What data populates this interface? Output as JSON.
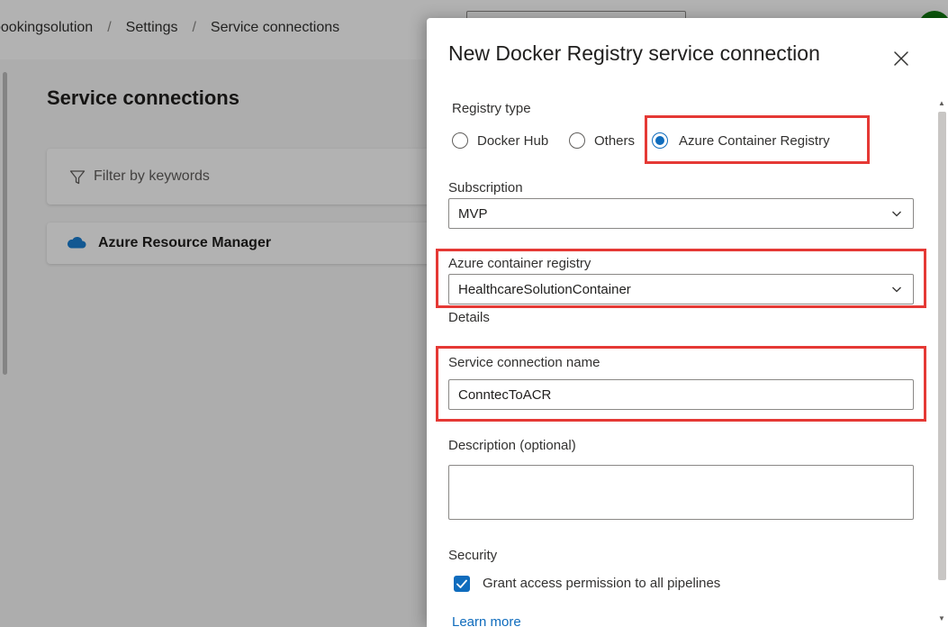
{
  "background": {
    "breadcrumb": [
      "bookingsolution",
      "Settings",
      "Service connections"
    ],
    "title": "Service connections",
    "filter_placeholder": "Filter by keywords",
    "connections": [
      "Azure Resource Manager"
    ]
  },
  "panel": {
    "title": "New Docker Registry service connection",
    "registry_type_label": "Registry type",
    "registry_types": [
      "Docker Hub",
      "Others",
      "Azure Container Registry"
    ],
    "registry_type_selected": "Azure Container Registry",
    "subscription_label": "Subscription",
    "subscription_value": "MVP",
    "acr_label": "Azure container registry",
    "acr_value": "HealthcareSolutionContainer",
    "details_label": "Details",
    "name_label": "Service connection name",
    "name_value": "ConntecToACR",
    "description_label": "Description (optional)",
    "description_value": "",
    "security_label": "Security",
    "grant_access_label": "Grant access permission to all pipelines",
    "grant_access_checked": true,
    "learn_more": "Learn more"
  },
  "icons": {
    "filter": "filter-icon",
    "cloud": "cloud-icon",
    "close": "close-icon",
    "chevron": "chevron-down-icon",
    "check": "check-icon"
  },
  "colors": {
    "accent": "#0f6cbd",
    "highlight": "#e53935",
    "cloud": "#1b7fd1"
  }
}
